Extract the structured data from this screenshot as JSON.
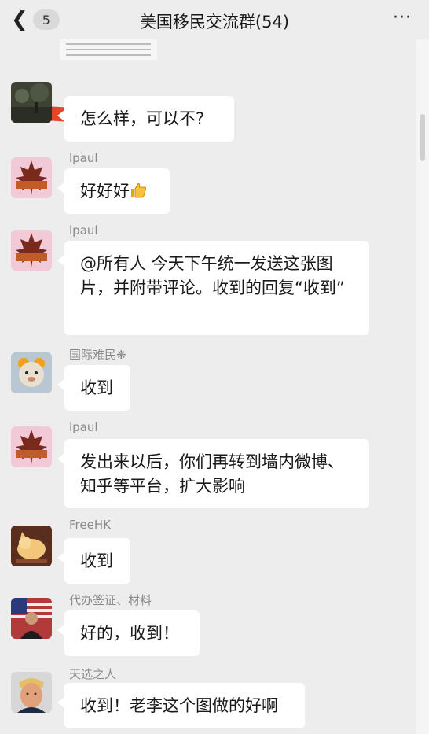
{
  "header": {
    "back_count": "5",
    "title": "美国移民交流群(54)",
    "more": "···"
  },
  "messages": [
    {
      "sender": "",
      "text": "怎么样，可以不?",
      "avatar": "dark-landscape-photo"
    },
    {
      "sender": "lpaul",
      "text": "好好好",
      "emoji": "thumbs-up",
      "avatar": "maple-leaf-logo"
    },
    {
      "sender": "lpaul",
      "text": "@所有人 今天下午统一发送这张图片，并附带评论。收到的回复“收到”",
      "avatar": "maple-leaf-logo"
    },
    {
      "sender": "国际难民❋",
      "text": "收到",
      "avatar": "bear-plush-toy"
    },
    {
      "sender": "lpaul",
      "text": "发出来以后，你们再转到墙内微博、知乎等平台，扩大影响",
      "avatar": "maple-leaf-logo"
    },
    {
      "sender": "FreeHK",
      "text": "收到",
      "avatar": "cartoon-cat"
    },
    {
      "sender": "代办签证、材料",
      "text": "好的，收到！",
      "avatar": "person-with-flag"
    },
    {
      "sender": "天选之人",
      "text": "收到！老李这个图做的好啊",
      "avatar": "man-portrait"
    }
  ],
  "colors": {
    "background": "#ededed",
    "bubble": "#ffffff",
    "name": "#8a8a8a",
    "redaction": "#e8432e"
  }
}
